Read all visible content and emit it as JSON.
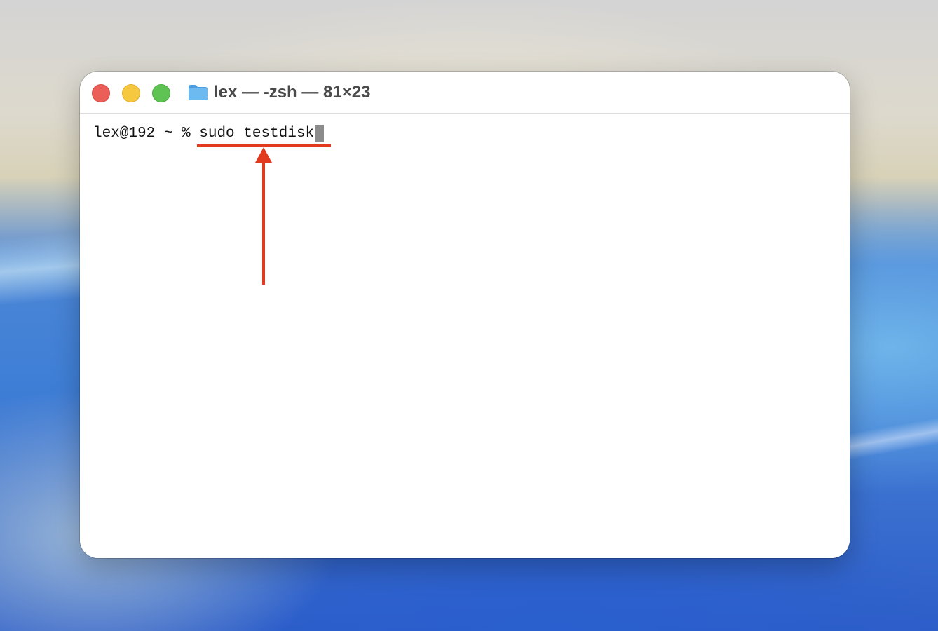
{
  "window": {
    "title": "lex — -zsh — 81×23"
  },
  "icons": {
    "folder": "folder-icon",
    "close": "close-button",
    "minimize": "minimize-button",
    "zoom": "zoom-button"
  },
  "terminal": {
    "prompt": "lex@192 ~ % ",
    "command": "sudo testdisk"
  },
  "colors": {
    "annotation": "#e23a1f",
    "close": "#ec5f59",
    "minimize": "#f5c840",
    "zoom": "#5fc354",
    "folder": "#5fb0ea",
    "cursor": "#8c8c8c"
  }
}
